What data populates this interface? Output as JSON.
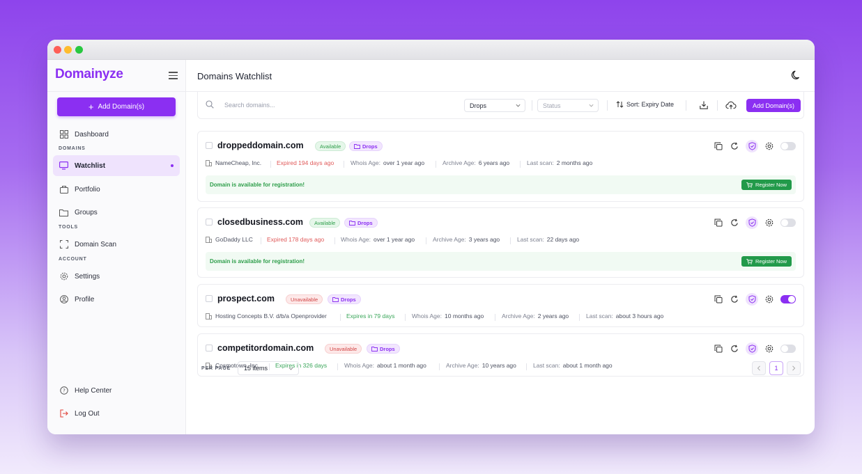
{
  "brand": "Domainyze",
  "sidebar": {
    "add_label": "Add Domain(s)",
    "dashboard": "Dashboard",
    "section_domains": "DOMAINS",
    "watchlist": "Watchlist",
    "portfolio": "Portfolio",
    "groups": "Groups",
    "section_tools": "TOOLS",
    "domain_scan": "Domain Scan",
    "section_account": "ACCOUNT",
    "settings": "Settings",
    "profile": "Profile",
    "help": "Help Center",
    "logout": "Log Out"
  },
  "header": {
    "title": "Domains Watchlist"
  },
  "toolbar": {
    "search_placeholder": "Search domains...",
    "type_filter": "Drops",
    "status_filter": "Status",
    "sort_label": "Sort: Expiry Date",
    "add_label": "Add Domain(s)"
  },
  "labels": {
    "whois": "Whois Age:",
    "archive": "Archive Age:",
    "lastscan": "Last scan:",
    "notice": "Domain is available for registration!",
    "register": "Register Now"
  },
  "domains": [
    {
      "name": "droppeddomain.com",
      "status": "Available",
      "tag": "Drops",
      "registrar": "NameCheap, Inc.",
      "expiry": "Expired 194 days ago",
      "whois": "over 1 year ago",
      "archive": "6 years ago",
      "lastscan": "2 months ago"
    },
    {
      "name": "closedbusiness.com",
      "status": "Available",
      "tag": "Drops",
      "registrar": "GoDaddy LLC",
      "expiry": "Expired 178 days ago",
      "whois": "over 1 year ago",
      "archive": "3 years ago",
      "lastscan": "22 days ago"
    },
    {
      "name": "prospect.com",
      "status": "Unavailable",
      "tag": "Drops",
      "registrar": "Hosting Concepts B.V. d/b/a Openprovider",
      "expiry": "Expires in 79 days",
      "whois": "10 months ago",
      "archive": "2 years ago",
      "lastscan": "about 3 hours ago"
    },
    {
      "name": "competitordomain.com",
      "status": "Unavailable",
      "tag": "Drops",
      "registrar": "Cosmotown, Inc.",
      "expiry": "Expires in 326 days",
      "whois": "about 1 month ago",
      "archive": "10 years ago",
      "lastscan": "about 1 month ago"
    }
  ],
  "pagination": {
    "per_page_label": "PER PAGE",
    "per_page_value": "15 items",
    "current_page": "1"
  },
  "colors": {
    "accent": "#8b2ff2",
    "success": "#229a4a",
    "danger": "#d24545"
  }
}
